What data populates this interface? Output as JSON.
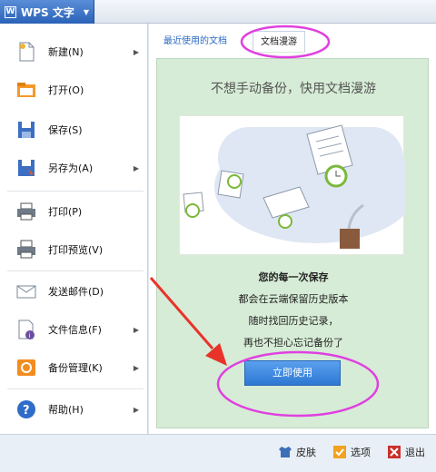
{
  "app": {
    "title": "WPS 文字",
    "logo_text": "W"
  },
  "menu": {
    "items": [
      {
        "label": "新建(N)",
        "icon": "new-doc-icon",
        "submenu": true
      },
      {
        "label": "打开(O)",
        "icon": "open-folder-icon",
        "submenu": false
      },
      {
        "label": "保存(S)",
        "icon": "save-icon",
        "submenu": false
      },
      {
        "label": "另存为(A)",
        "icon": "save-as-icon",
        "submenu": true
      },
      {
        "label": "打印(P)",
        "icon": "printer-icon",
        "submenu": false
      },
      {
        "label": "打印预览(V)",
        "icon": "print-preview-icon",
        "submenu": false
      },
      {
        "label": "发送邮件(D)",
        "icon": "mail-icon",
        "submenu": false
      },
      {
        "label": "文件信息(F)",
        "icon": "file-info-icon",
        "submenu": true
      },
      {
        "label": "备份管理(K)",
        "icon": "backup-icon",
        "submenu": true
      },
      {
        "label": "帮助(H)",
        "icon": "help-icon",
        "submenu": true
      }
    ]
  },
  "tabs": {
    "recent": "最近使用的文档",
    "roaming": "文档漫游"
  },
  "panel": {
    "headline": "不想手动备份，快用文档漫游",
    "line1": "您的每一次保存",
    "line2": "都会在云端保留历史版本",
    "line3": "随时找回历史记录，",
    "line4": "再也不担心忘记备份了",
    "button": "立即使用"
  },
  "bottom": {
    "skin": "皮肤",
    "options": "选项",
    "exit": "退出"
  },
  "colors": {
    "accent": "#2d78d3",
    "panel_bg": "#d6ecd6",
    "annotation": "#e040e0",
    "arrow": "#e8332a"
  }
}
